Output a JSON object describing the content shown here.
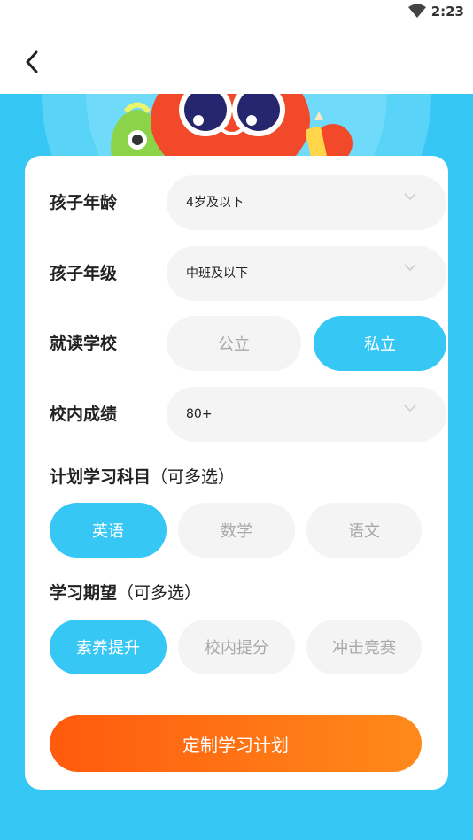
{
  "status_bar": {
    "time": "2:23",
    "icons": [
      "wifi-icon"
    ]
  },
  "nav": {
    "back_icon": "chevron-left-icon"
  },
  "form": {
    "age": {
      "label": "孩子年龄",
      "value": "4岁及以下"
    },
    "grade": {
      "label": "孩子年级",
      "value": "中班及以下"
    },
    "school": {
      "label": "就读学校",
      "options": [
        "公立",
        "私立"
      ],
      "selected": "私立"
    },
    "score": {
      "label": "校内成绩",
      "value": "80+"
    },
    "subjects": {
      "title": "计划学习科目",
      "note": "（可多选）",
      "options": [
        "英语",
        "数学",
        "语文"
      ],
      "selected": [
        "英语"
      ]
    },
    "goals": {
      "title": "学习期望",
      "note": "（可多选）",
      "options": [
        "素养提升",
        "校内提分",
        "冲击竞赛"
      ],
      "selected": [
        "素养提升"
      ]
    },
    "submit_label": "定制学习计划"
  },
  "colors": {
    "accent": "#37c7f5",
    "button_gradient_start": "#ff5a0e",
    "button_gradient_end": "#ff8a1a",
    "mascot": "#f2492a"
  }
}
